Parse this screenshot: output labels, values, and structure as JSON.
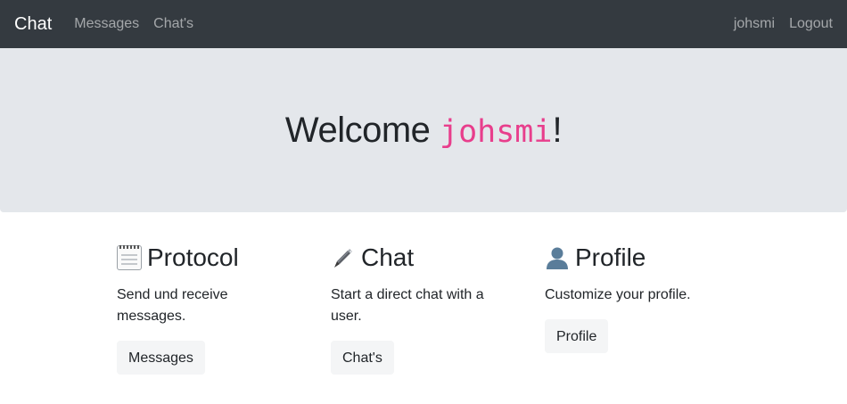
{
  "navbar": {
    "brand": "Chat",
    "links": [
      "Messages",
      "Chat's"
    ],
    "user": "johsmi",
    "logout": "Logout"
  },
  "hero": {
    "prefix": "Welcome ",
    "username": "johsmi",
    "suffix": "!"
  },
  "cards": [
    {
      "icon": "notepad-icon",
      "title": "Protocol",
      "text": "Send und receive messages.",
      "button": "Messages"
    },
    {
      "icon": "pen-icon",
      "title": "Chat",
      "text": "Start a direct chat with a user.",
      "button": "Chat's"
    },
    {
      "icon": "person-icon",
      "title": "Profile",
      "text": "Customize your profile.",
      "button": "Profile"
    }
  ]
}
